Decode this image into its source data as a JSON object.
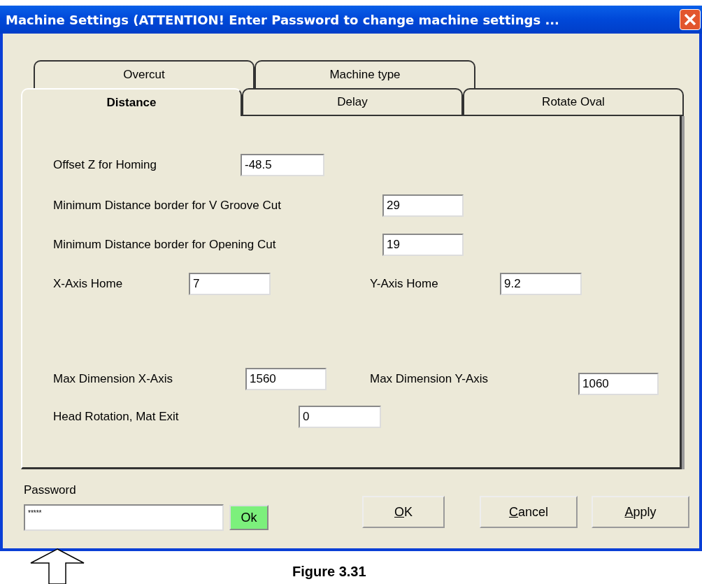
{
  "window": {
    "title": "Machine Settings (ATTENTION! Enter Password to change machine settings ..."
  },
  "tabs_back": [
    {
      "label": "Overcut",
      "selected": false
    },
    {
      "label": "Machine type",
      "selected": false
    }
  ],
  "tabs_front": [
    {
      "label": "Distance",
      "selected": true
    },
    {
      "label": "Delay",
      "selected": false
    },
    {
      "label": "Rotate Oval",
      "selected": false
    }
  ],
  "rows": [
    [
      {
        "label": "Offset Z for Homing",
        "value": "-48.5"
      }
    ],
    [
      {
        "label": "Minimum Distance border for V Groove Cut",
        "value": "29"
      }
    ],
    [
      {
        "label": "Minimum Distance border for Opening Cut",
        "value": "19"
      }
    ],
    [
      {
        "label": "X-Axis Home",
        "value": "7"
      },
      {
        "label": "Y-Axis Home",
        "value": "9.2"
      }
    ],
    [
      {
        "label": "Max Dimension X-Axis",
        "value": "1560"
      },
      {
        "label": "Max Dimension Y-Axis",
        "value": "1060"
      }
    ],
    [
      {
        "label": "Head Rotation, Mat Exit",
        "value": "0"
      }
    ]
  ],
  "password": {
    "label": "Password",
    "value": "*****",
    "ok_button": "Ok"
  },
  "buttons": [
    {
      "label": "OK",
      "underline_first": true
    },
    {
      "label": "Cancel",
      "underline_first": true
    },
    {
      "label": "Apply",
      "underline_first": true
    }
  ],
  "caption": "Figure 3.31"
}
